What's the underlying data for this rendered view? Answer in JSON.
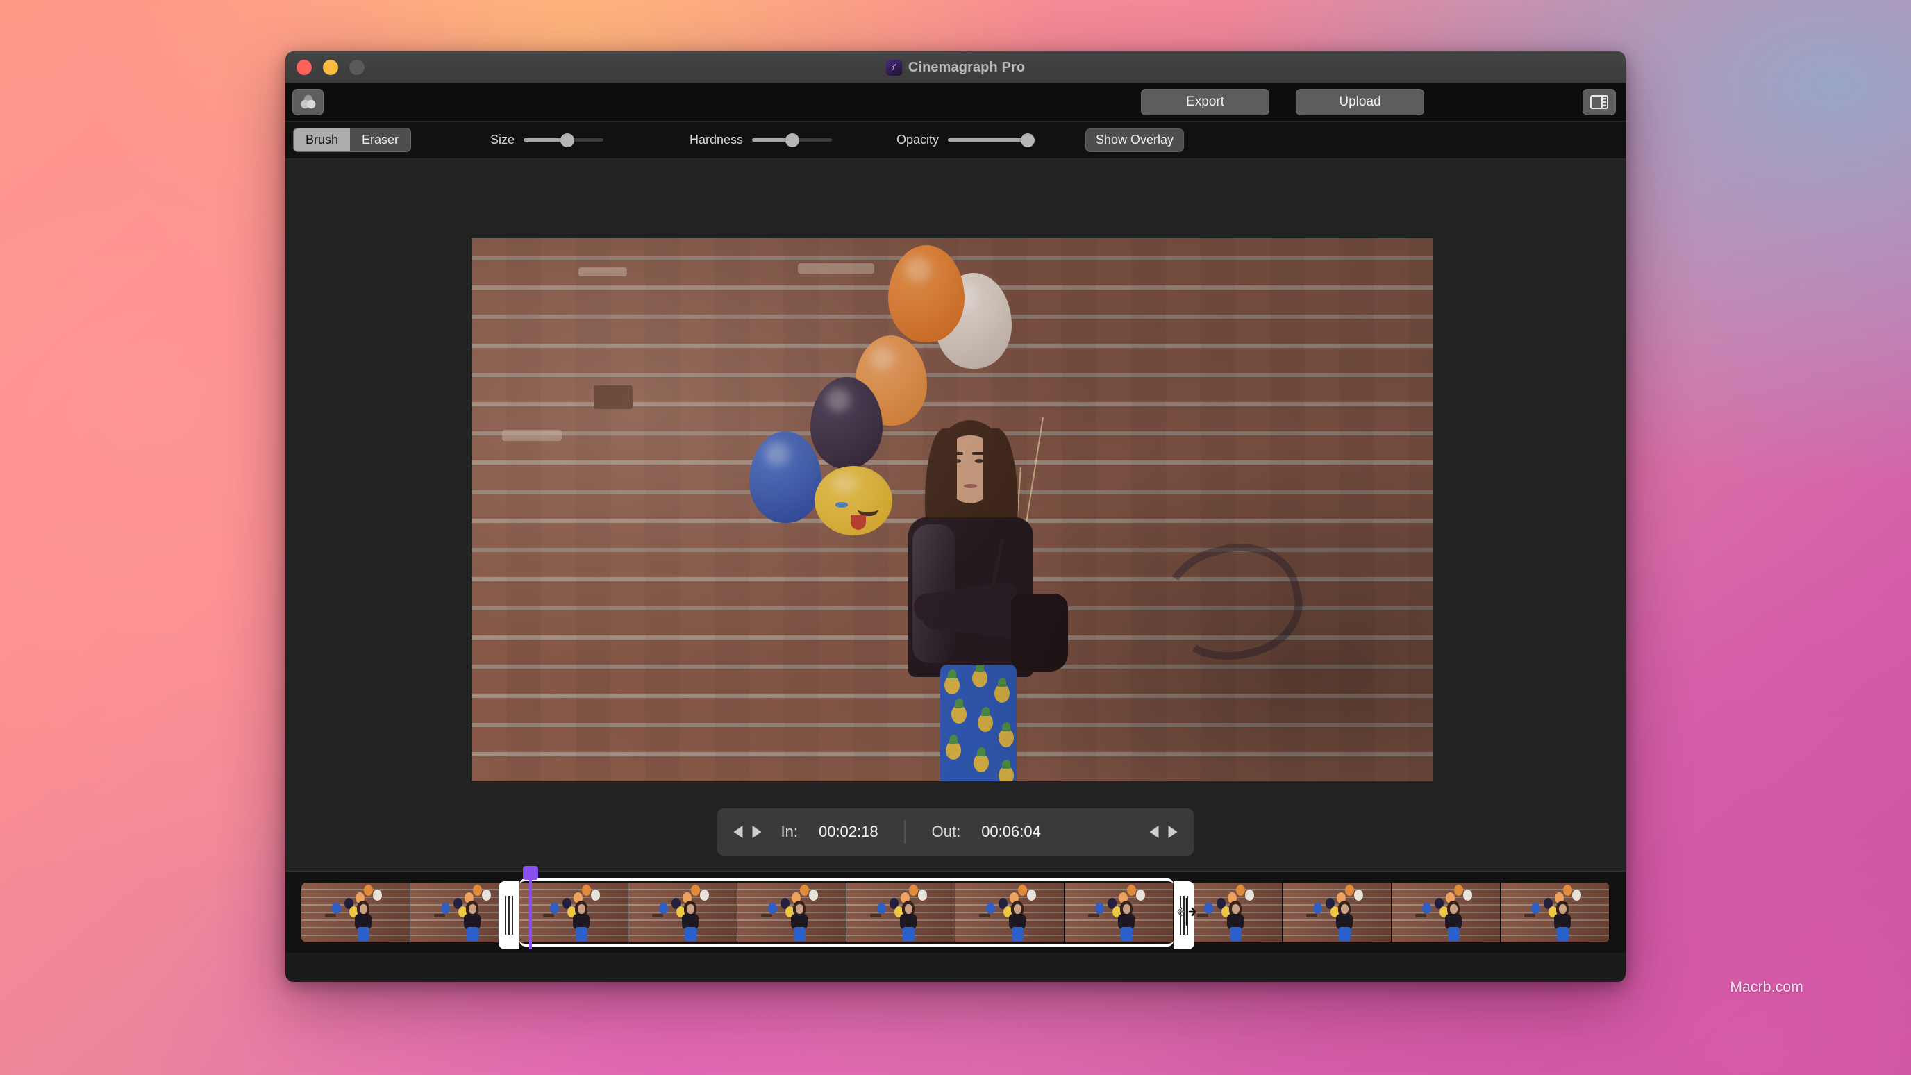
{
  "desktop": {
    "watermark": "Macrb.com",
    "bg_colors": [
      "#ff9a86",
      "#9aa8c8",
      "#d45fa8",
      "#ffba78"
    ]
  },
  "window": {
    "title": "Cinemagraph Pro",
    "app_icon": "cinemagraph-pro-icon",
    "traffic_lights": [
      {
        "name": "close",
        "color": "#fc6058"
      },
      {
        "name": "minimize",
        "color": "#fdbc40"
      },
      {
        "name": "maximize",
        "color": "#5a5a5a"
      }
    ]
  },
  "toolbar": {
    "layers_icon": "three-circles-icon",
    "export_label": "Export",
    "upload_label": "Upload",
    "panel_toggle_icon": "sidebar-panel-icon"
  },
  "brushbar": {
    "mode_segments": [
      {
        "label": "Brush",
        "selected": true
      },
      {
        "label": "Eraser",
        "selected": false
      }
    ],
    "sliders": [
      {
        "label": "Size",
        "value": 55
      },
      {
        "label": "Hardness",
        "value": 50
      },
      {
        "label": "Opacity",
        "value": 100
      }
    ],
    "overlay_label": "Show Overlay"
  },
  "preview": {
    "description": "Woman in black leather jacket and blue pineapple-print outfit standing against a red brick wall holding balloons",
    "balloons": [
      "orange",
      "white",
      "light-orange",
      "navy",
      "blue",
      "yellow-emoji"
    ]
  },
  "inout": {
    "prev_icon": "triangle-left-icon",
    "next_icon": "triangle-right-icon",
    "in_label": "In:",
    "in_value": "00:02:18",
    "out_label": "Out:",
    "out_value": "00:06:04"
  },
  "timeline": {
    "frame_count": 12,
    "selection_start_frame": 2,
    "selection_end_frame": 8,
    "playhead_frame": 2,
    "playhead_color": "#8a4ff0",
    "handle_color": "#ffffff",
    "left_handle_icon": "trim-handle-left",
    "right_handle_icon": "trim-handle-right",
    "cursor": "resize-horizontal-cursor"
  }
}
